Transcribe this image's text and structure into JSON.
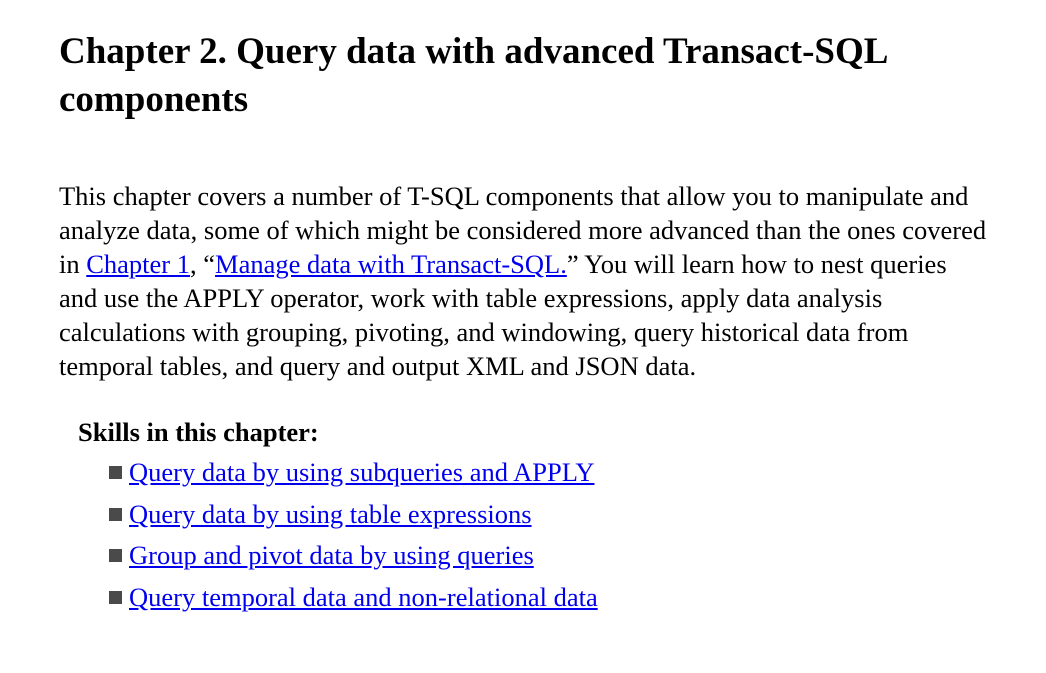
{
  "chapter": {
    "title": "Chapter 2. Query data with advanced Transact-SQL components"
  },
  "intro": {
    "text_before_link": "This chapter covers a number of T-SQL components that allow you to manipulate and analyze data, some of which might be considered more advanced than the ones covered in ",
    "chapter_link": "Chapter 1",
    "text_middle": ", “",
    "title_link": "Manage data with Transact-SQL.",
    "text_after": "” You will learn how to nest queries and use the APPLY operator, work with table expressions, apply data analysis calculations with grouping, pivoting, and windowing, query historical data from temporal tables, and query and output XML and JSON data."
  },
  "skills": {
    "heading": "Skills in this chapter:",
    "items": [
      {
        "label": "Query data by using subqueries and APPLY"
      },
      {
        "label": "Query data by using table expressions"
      },
      {
        "label": "Group and pivot data by using queries"
      },
      {
        "label": "Query temporal data and non-relational data"
      }
    ]
  },
  "icons": {
    "bullet": "square-bullet-icon"
  },
  "colors": {
    "link": "#0000ee",
    "bullet": "#4a4a4a"
  }
}
